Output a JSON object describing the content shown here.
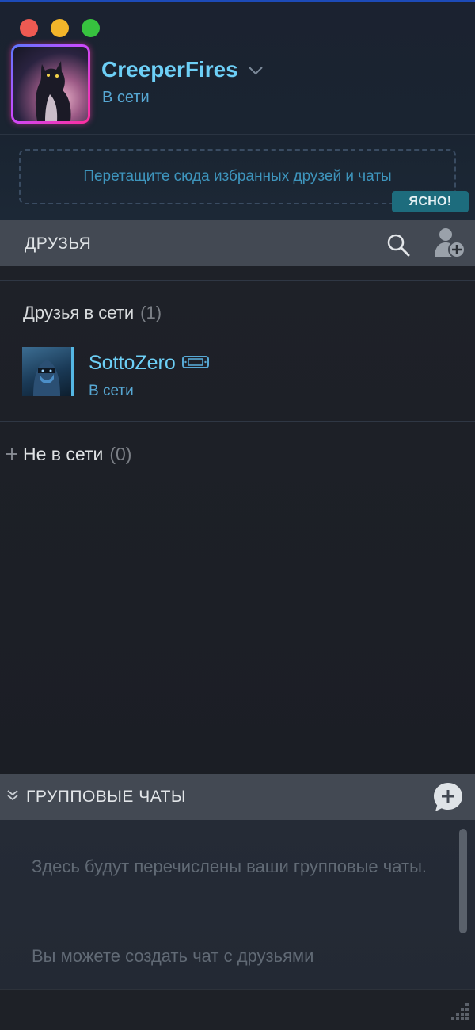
{
  "window": {
    "controls": [
      "close",
      "minimize",
      "maximize"
    ]
  },
  "profile": {
    "username": "CreeperFires",
    "status": "В сети",
    "dropdown_icon": "chevron-down-icon"
  },
  "favorites": {
    "drop_text": "Перетащите сюда избранных друзей и чаты",
    "clear_label": "ЯСНО!"
  },
  "friends_bar": {
    "title": "ДРУЗЬЯ",
    "search_icon": "search-icon",
    "add_friend_icon": "add-friend-icon"
  },
  "friends": {
    "online_section": {
      "label": "Друзья в сети",
      "count": "(1)"
    },
    "online_list": [
      {
        "name": "SottoZero",
        "status": "В сети",
        "device_icon": "handheld-console-icon"
      }
    ],
    "offline_section": {
      "label": "Не в сети",
      "count": "(0)",
      "expand_icon": "plus-icon"
    }
  },
  "group_chats": {
    "title": "ГРУППОВЫЕ ЧАТЫ",
    "collapse_icon": "double-chevron-down-icon",
    "new_chat_icon": "new-chat-icon",
    "empty_text": "Здесь будут перечислены ваши групповые чаты.",
    "hint_text": "Вы можете создать чат с друзьями"
  },
  "colors": {
    "accent_blue": "#6dcff6",
    "status_blue": "#57a8d4",
    "bar_gray": "#434953",
    "clear_button": "#1d6c7d",
    "avatar_frame": "#ff2d9b"
  }
}
